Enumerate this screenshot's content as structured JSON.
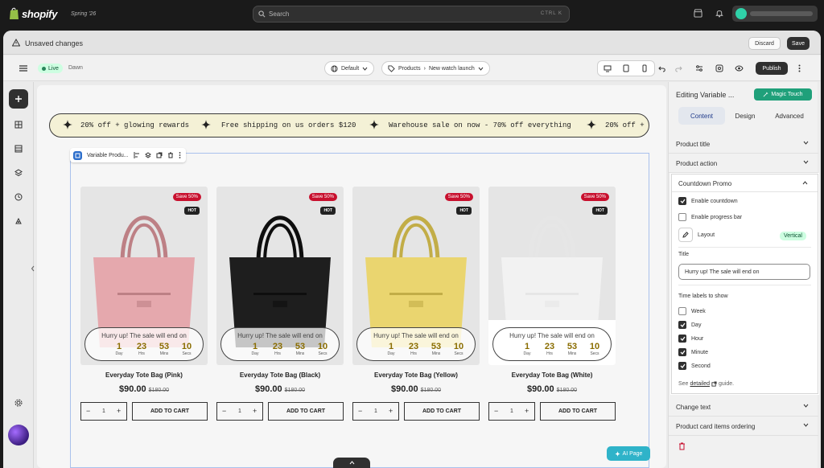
{
  "topbar": {
    "brand": "shopify",
    "version": "Spring '26",
    "search_placeholder": "Search",
    "search_shortcut": "CTRL K"
  },
  "unsaved": {
    "label": "Unsaved changes",
    "discard": "Discard",
    "save": "Save"
  },
  "toolbar": {
    "live_badge": "Live",
    "theme": "Dawn",
    "template": "Default",
    "products_label": "Products",
    "product_name": "New watch launch",
    "publish": "Publish"
  },
  "marquee": [
    "20% off + glowing rewards",
    "Free shipping on us orders $120",
    "Warehouse sale on now - 70% off everything",
    "20% off +"
  ],
  "section_label": "Variable Produ...",
  "countdown": {
    "message": "Hurry up! The sale will end on",
    "units": [
      {
        "value": "1",
        "label": "Day"
      },
      {
        "value": "23",
        "label": "Hrs"
      },
      {
        "value": "53",
        "label": "Mins"
      },
      {
        "value": "10",
        "label": "Secs"
      }
    ]
  },
  "products": [
    {
      "name": "Everyday Tote Bag (Pink)",
      "price": "$90.00",
      "compare": "$180.00",
      "sale": "Save 50%",
      "hot": "HOT",
      "qty": "1",
      "cart": "ADD TO CART",
      "color": "#e5a8ad"
    },
    {
      "name": "Everyday Tote Bag (Black)",
      "price": "$90.00",
      "compare": "$180.00",
      "sale": "Save 50%",
      "hot": "HOT",
      "qty": "1",
      "cart": "ADD TO CART",
      "color": "#1e1e1e"
    },
    {
      "name": "Everyday Tote Bag (Yellow)",
      "price": "$90.00",
      "compare": "$180.00",
      "sale": "Save 50%",
      "hot": "HOT",
      "qty": "1",
      "cart": "ADD TO CART",
      "color": "#ead56f"
    },
    {
      "name": "Everyday Tote Bag (White)",
      "price": "$90.00",
      "compare": "$180.00",
      "sale": "Save 50%",
      "hot": "HOT",
      "qty": "1",
      "cart": "ADD TO CART",
      "color": "#f2f2f2"
    }
  ],
  "ai_button": "AI Page",
  "panel": {
    "editing_title": "Editing Variable ...",
    "magic_button": "Magic Touch",
    "tabs": [
      "Content",
      "Design",
      "Advanced"
    ],
    "product_title": "Product title",
    "product_action": "Product action",
    "promo_title": "Countdown Promo",
    "enable_countdown": "Enable countdown",
    "enable_progress": "Enable progress bar",
    "layout_label": "Layout",
    "layout_value": "Vertical",
    "title_label": "Title",
    "title_value": "Hurry up! The sale will end on",
    "time_labels_heading": "Time labels to show",
    "time_labels": [
      {
        "label": "Week",
        "checked": false
      },
      {
        "label": "Day",
        "checked": true
      },
      {
        "label": "Hour",
        "checked": true
      },
      {
        "label": "Minute",
        "checked": true
      },
      {
        "label": "Second",
        "checked": true
      }
    ],
    "guide_prefix": "See",
    "guide_link": "detailed",
    "guide_suffix": "guide.",
    "change_text": "Change text",
    "ordering": "Product card items ordering"
  },
  "colors": {
    "accent_live": "#29845a",
    "magic": "#1fa07a",
    "publish": "#303030"
  }
}
